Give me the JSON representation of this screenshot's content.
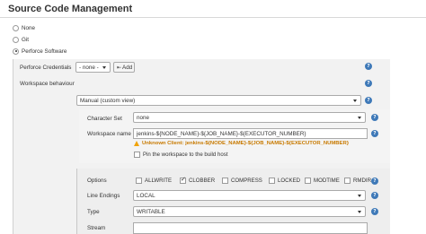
{
  "page_title": "Source Code Management",
  "scm_options": [
    {
      "label": "None",
      "checked": false
    },
    {
      "label": "Git",
      "checked": false
    },
    {
      "label": "Perforce Software",
      "checked": true
    }
  ],
  "perforce": {
    "credentials_label": "Perforce Credentials",
    "credentials_value": "- none -",
    "add_label": "Add",
    "workspace_behaviour_label": "Workspace behaviour",
    "workspace_type_value": "Manual (custom view)"
  },
  "workspace": {
    "charset_label": "Character Set",
    "charset_value": "none",
    "name_label": "Workspace name",
    "name_value": "jenkins-${NODE_NAME}-${JOB_NAME}-${EXECUTOR_NUMBER}",
    "warning": "Unknown Client: jenkins-${NODE_NAME}-${JOB_NAME}-${EXECUTOR_NUMBER}",
    "pin_label": "Pin the workspace to the build host",
    "pin_checked": false
  },
  "spec": {
    "options_label": "Options",
    "options": [
      {
        "label": "ALLWRITE",
        "checked": false
      },
      {
        "label": "CLOBBER",
        "checked": true
      },
      {
        "label": "COMPRESS",
        "checked": false
      },
      {
        "label": "LOCKED",
        "checked": false
      },
      {
        "label": "MODTIME",
        "checked": false
      },
      {
        "label": "RMDIR",
        "checked": false
      }
    ],
    "line_endings_label": "Line Endings",
    "line_endings_value": "LOCAL",
    "type_label": "Type",
    "type_value": "WRITABLE",
    "stream_label": "Stream",
    "stream_value": ""
  },
  "help_glyph": "?",
  "colors": {
    "help": "#3e79b8",
    "warning": "#c87a00",
    "section_bg": "#f2f2f2"
  }
}
